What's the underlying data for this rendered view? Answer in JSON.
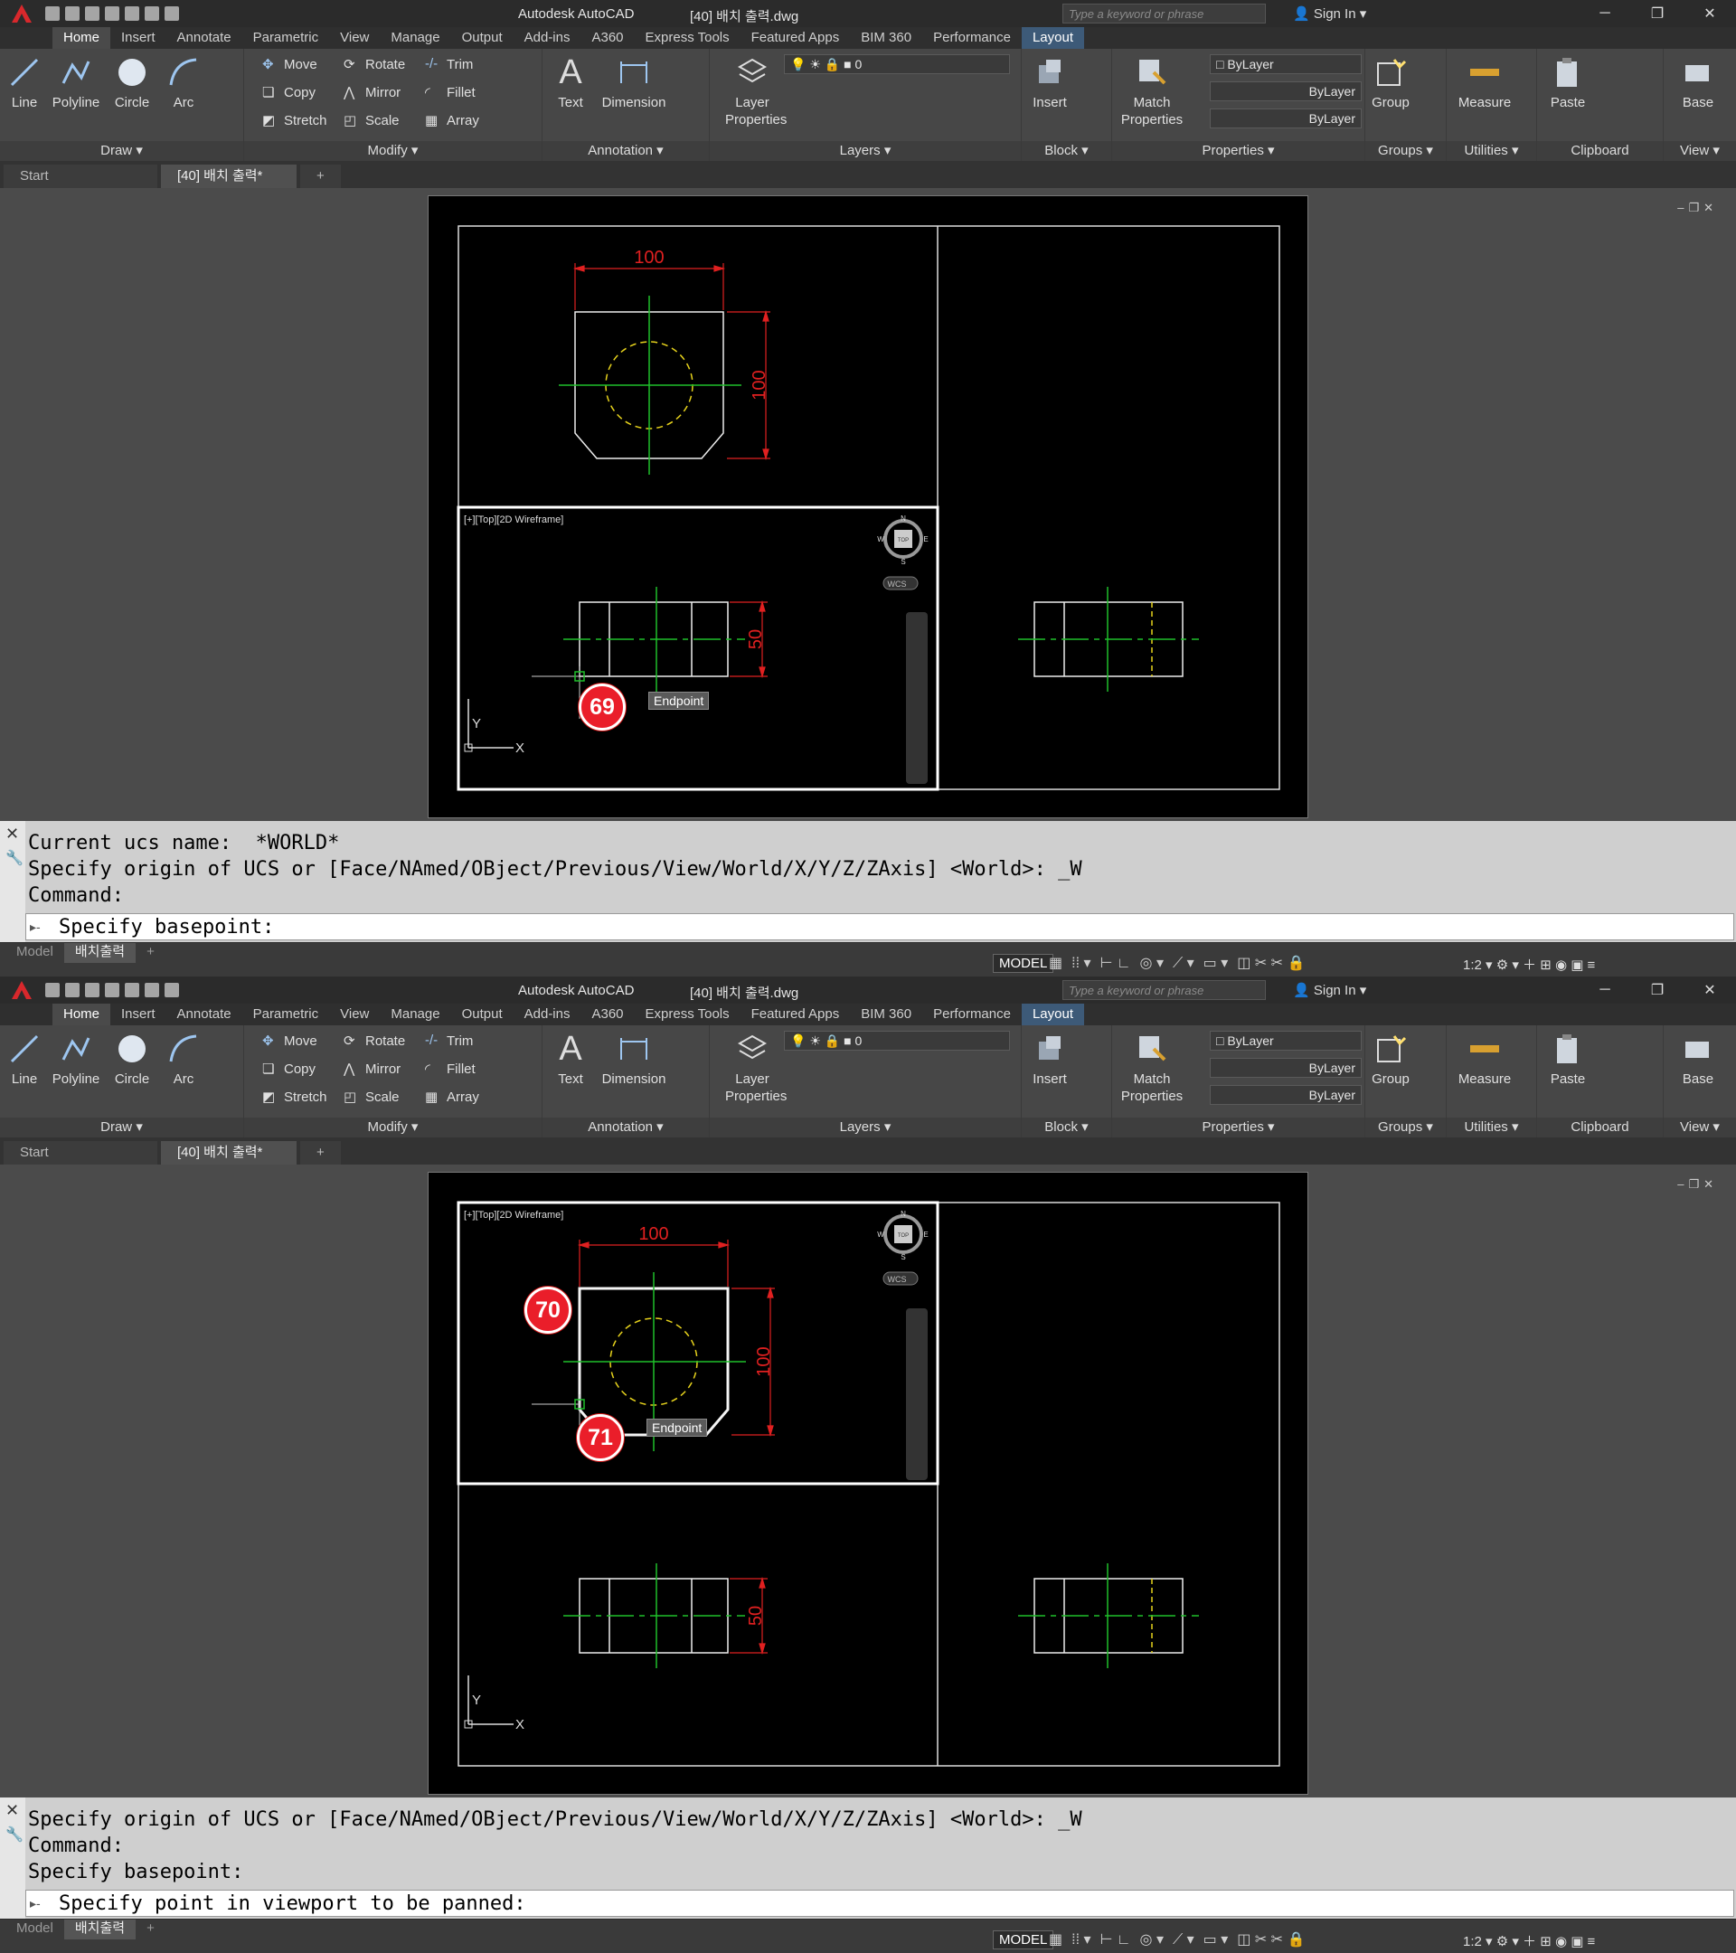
{
  "app": {
    "title": "Autodesk AutoCAD",
    "doc": "[40] 배치 출력.dwg",
    "search_placeholder": "Type a keyword or phrase",
    "sign_in": "Sign In"
  },
  "tabs": [
    "Home",
    "Insert",
    "Annotate",
    "Parametric",
    "View",
    "Manage",
    "Output",
    "Add-ins",
    "A360",
    "Express Tools",
    "Featured Apps",
    "BIM 360",
    "Performance",
    "Layout"
  ],
  "ribbon": {
    "draw": {
      "title": "Draw",
      "line": "Line",
      "polyline": "Polyline",
      "circle": "Circle",
      "arc": "Arc"
    },
    "modify": {
      "title": "Modify",
      "move": "Move",
      "rotate": "Rotate",
      "trim": "Trim",
      "copy": "Copy",
      "mirror": "Mirror",
      "fillet": "Fillet",
      "stretch": "Stretch",
      "scale": "Scale",
      "array": "Array"
    },
    "annotation": {
      "title": "Annotation",
      "text": "Text",
      "dimension": "Dimension"
    },
    "layers": {
      "title": "Layers",
      "layer_properties": "Layer Properties",
      "current_layer": "0"
    },
    "block": {
      "title": "Block",
      "insert": "Insert"
    },
    "properties": {
      "title": "Properties",
      "match": "Match Properties",
      "color": "ByLayer",
      "linetype": "ByLayer",
      "lineweight": "ByLayer"
    },
    "groups": {
      "title": "Groups",
      "group": "Group"
    },
    "utilities": {
      "title": "Utilities",
      "measure": "Measure"
    },
    "clipboard": {
      "title": "Clipboard",
      "paste": "Paste"
    },
    "view": {
      "title": "View",
      "base": "Base"
    }
  },
  "filetabs": {
    "start": "Start",
    "doc": "[40] 배치 출력*"
  },
  "viewport": {
    "label": "[+][Top][2D Wireframe]",
    "wcs": "WCS",
    "compass": {
      "n": "N",
      "s": "S",
      "e": "E",
      "w": "W",
      "top": "TOP"
    }
  },
  "dims": {
    "width": "100",
    "height": "100",
    "side": "50"
  },
  "tooltip": "Endpoint",
  "markers": {
    "a": "69",
    "b": "70",
    "c": "71"
  },
  "ucs": {
    "x": "X",
    "y": "Y"
  },
  "layouts": {
    "model": "Model",
    "layout": "배치출력"
  },
  "status": {
    "model": "MODEL",
    "scale": "1:2"
  },
  "screen1": {
    "cmd": [
      "Current ucs name:  *WORLD*",
      "Specify origin of UCS or [Face/NAmed/OBject/Previous/View/World/X/Y/Z/ZAxis] <World>: _W",
      "Command:"
    ],
    "prompt": "Specify basepoint:"
  },
  "screen2": {
    "cmd": [
      "Specify origin of UCS or [Face/NAmed/OBject/Previous/View/World/X/Y/Z/ZAxis] <World>: _W",
      "Command:",
      "Specify basepoint:"
    ],
    "prompt": "Specify point in viewport to be panned:"
  }
}
